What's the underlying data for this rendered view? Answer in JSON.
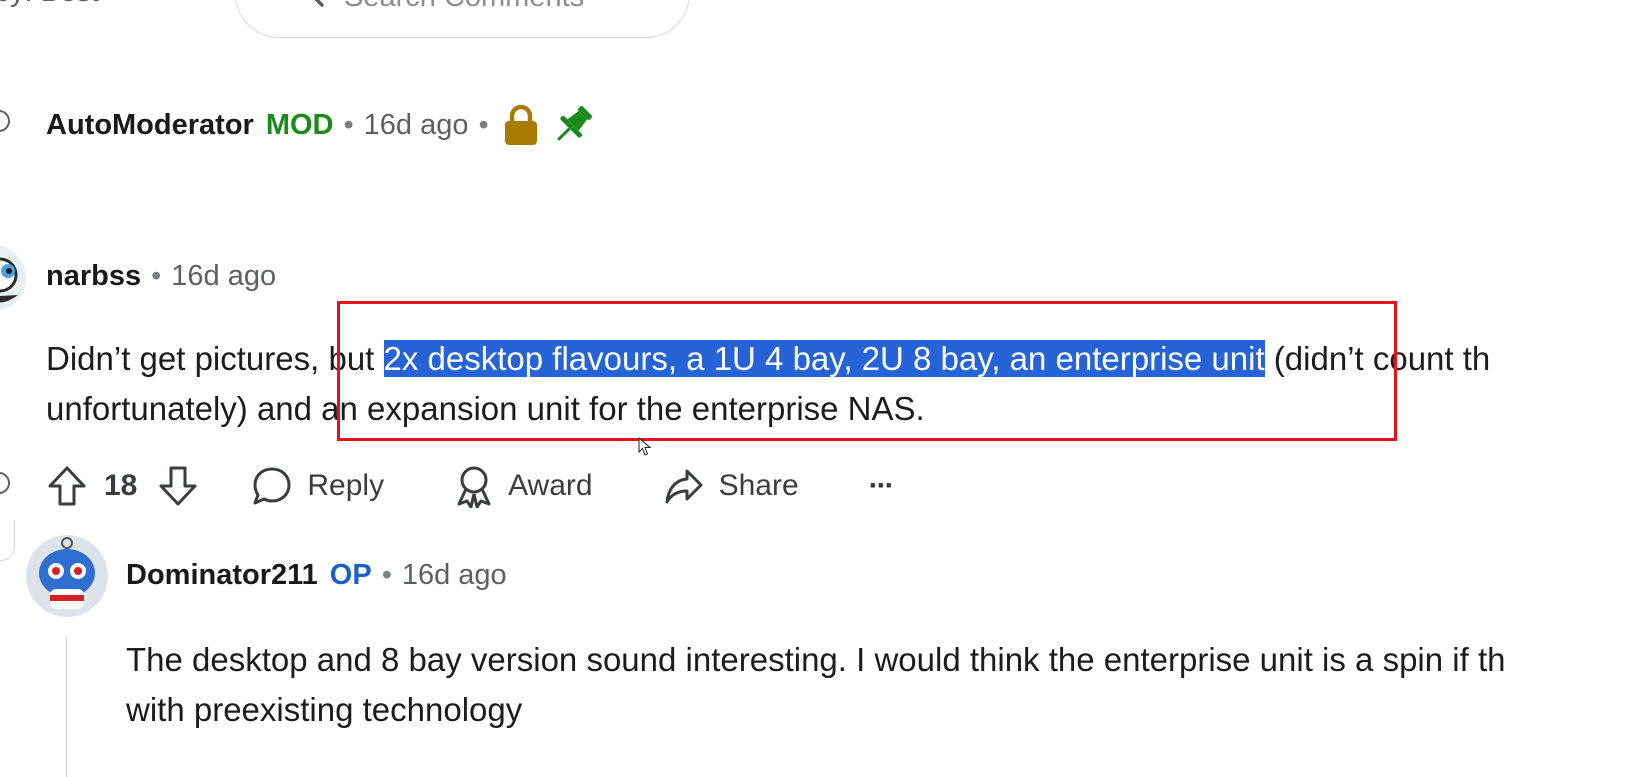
{
  "sort": {
    "fragment": "by: Best"
  },
  "search": {
    "placeholder": "Search Comments"
  },
  "comments": [
    {
      "author": "AutoModerator",
      "badge": "MOD",
      "separator": "•",
      "time": "16d ago",
      "icons": [
        "lock-icon",
        "pin-icon"
      ],
      "colors": {
        "badge": "#1a8a1a",
        "lock": "#a87a00",
        "pin": "#1a8a1a"
      }
    },
    {
      "author": "narbss",
      "separator": "•",
      "time": "16d ago",
      "body": {
        "line1_pre": "Didn’t get pictures, but ",
        "line1_highlight": "2x desktop flavours, a 1U 4 bay, 2U 8 bay, an enterprise unit",
        "line1_post": " (didn’t count th",
        "line2": "unfortunately) and an expansion unit for the enterprise NAS."
      },
      "actions": {
        "upvote_icon": "upvote-icon",
        "score": "18",
        "downvote_icon": "downvote-icon",
        "reply": "Reply",
        "award": "Award",
        "share": "Share",
        "more": "···"
      },
      "colors": {
        "highlight_bg": "#2563d6",
        "annotation_box": "#e2141c"
      }
    },
    {
      "author": "Dominator211",
      "badge": "OP",
      "separator": "•",
      "time": "16d ago",
      "body": {
        "line1": "The desktop and 8 bay version sound interesting. I would think the enterprise unit is a spin if th",
        "line2": "with preexisting technology"
      },
      "colors": {
        "badge": "#1b5fc9"
      }
    }
  ]
}
